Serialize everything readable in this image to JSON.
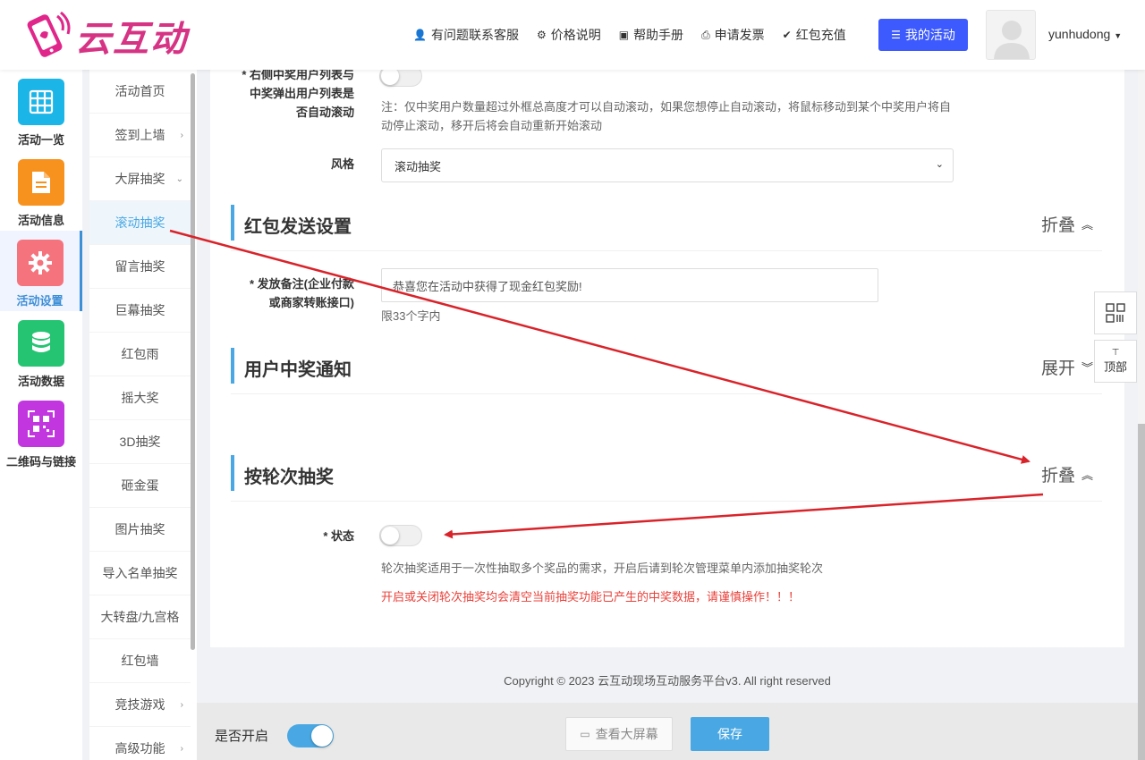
{
  "header": {
    "logo_text": "云互动",
    "nav": [
      {
        "icon": "user-plus-icon",
        "glyph": "👤",
        "label": "有问题联系客服"
      },
      {
        "icon": "gear-icon",
        "glyph": "⚙",
        "label": "价格说明"
      },
      {
        "icon": "book-icon",
        "glyph": "▣",
        "label": "帮助手册"
      },
      {
        "icon": "printer-icon",
        "glyph": "⎙",
        "label": "申请发票"
      },
      {
        "icon": "shield-check-icon",
        "glyph": "✔",
        "label": "红包充值"
      }
    ],
    "my_activity": "我的活动",
    "username": "yunhudong"
  },
  "iconbar": [
    {
      "label": "活动一览",
      "color": "#1bb5e8",
      "icon": "grid-icon"
    },
    {
      "label": "活动信息",
      "color": "#f7921e",
      "icon": "document-icon"
    },
    {
      "label": "活动设置",
      "color": "#f5737d",
      "icon": "gear-icon"
    },
    {
      "label": "活动数据",
      "color": "#25c472",
      "icon": "database-icon"
    },
    {
      "label": "二维码与链接",
      "color": "#c236e0",
      "icon": "qrcode-icon"
    }
  ],
  "submenu": [
    {
      "label": "活动首页",
      "chev": ""
    },
    {
      "label": "签到上墙",
      "chev": "›"
    },
    {
      "label": "大屏抽奖",
      "chev": "⌄"
    },
    {
      "label": "滚动抽奖",
      "chev": ""
    },
    {
      "label": "留言抽奖",
      "chev": ""
    },
    {
      "label": "巨幕抽奖",
      "chev": ""
    },
    {
      "label": "红包雨",
      "chev": ""
    },
    {
      "label": "摇大奖",
      "chev": ""
    },
    {
      "label": "3D抽奖",
      "chev": ""
    },
    {
      "label": "砸金蛋",
      "chev": ""
    },
    {
      "label": "图片抽奖",
      "chev": ""
    },
    {
      "label": "导入名单抽奖",
      "chev": ""
    },
    {
      "label": "大转盘/九宫格",
      "chev": ""
    },
    {
      "label": "红包墙",
      "chev": ""
    },
    {
      "label": "竞技游戏",
      "chev": "›"
    },
    {
      "label": "高级功能",
      "chev": "›"
    }
  ],
  "form": {
    "autoscroll_label_1": "* 右侧中奖用户列表与",
    "autoscroll_label_2": "中奖弹出用户列表是",
    "autoscroll_label_3": "否自动滚动",
    "autoscroll_note": "注：仅中奖用户数量超过外框总高度才可以自动滚动，如果您想停止自动滚动，将鼠标移动到某个中奖用户将自动停止滚动，移开后将会自动重新开始滚动",
    "style_label": "风格",
    "style_value": "滚动抽奖",
    "redpacket_section": "红包发送设置",
    "redpacket_toggle": "折叠",
    "remark_label_1": "* 发放备注(企业付款",
    "remark_label_2": "或商家转账接口)",
    "remark_value": "恭喜您在活动中获得了现金红包奖励!",
    "remark_hint": "限33个字内",
    "notify_section": "用户中奖通知",
    "notify_toggle": "展开",
    "round_section": "按轮次抽奖",
    "round_toggle": "折叠",
    "status_label": "* 状态",
    "status_note": "轮次抽奖适用于一次性抽取多个奖品的需求，开启后请到轮次管理菜单内添加抽奖轮次",
    "status_warn": "开启或关闭轮次抽奖均会清空当前抽奖功能已产生的中奖数据，请谨慎操作！！！"
  },
  "float": {
    "qr_icon": "qrcode-icon",
    "top_label": "顶部"
  },
  "copyright": "Copyright © 2023 云互动现场互动服务平台v3. All right reserved",
  "bottombar": {
    "enable_label": "是否开启",
    "view_screen": "查看大屏幕",
    "save": "保存"
  },
  "colors": {
    "accent": "#49a8e3",
    "primary_button": "#3d5afe",
    "warning": "#e8413a",
    "annotation_arrow": "#d9232a"
  }
}
